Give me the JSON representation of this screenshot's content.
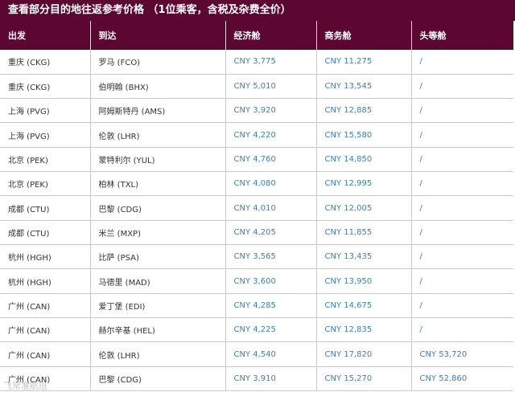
{
  "title": "查看部分目的地往返参考价格 （1位乘客，含税及杂费全价）",
  "columns": [
    "出发",
    "到达",
    "经济舱",
    "商务舱",
    "头等舱"
  ],
  "rows": [
    {
      "origin": "重庆 (CKG)",
      "destination": "罗马 (FCO)",
      "economy": "CNY 3,775",
      "business": "CNY 11,275",
      "first": "/"
    },
    {
      "origin": "重庆 (CKG)",
      "destination": "伯明翰 (BHX)",
      "economy": "CNY 5,010",
      "business": "CNY 13,545",
      "first": "/"
    },
    {
      "origin": "上海 (PVG)",
      "destination": "阿姆斯特丹 (AMS)",
      "economy": "CNY 3,920",
      "business": "CNY 12,885",
      "first": "/"
    },
    {
      "origin": "上海 (PVG)",
      "destination": "伦敦 (LHR)",
      "economy": "CNY 4,220",
      "business": "CNY 15,580",
      "first": "/"
    },
    {
      "origin": "北京 (PEK)",
      "destination": "蒙特利尔 (YUL)",
      "economy": "CNY 4,760",
      "business": "CNY 14,850",
      "first": "/"
    },
    {
      "origin": "北京 (PEK)",
      "destination": "柏林 (TXL)",
      "economy": "CNY 4,080",
      "business": "CNY 12,995",
      "first": "/"
    },
    {
      "origin": "成都 (CTU)",
      "destination": "巴黎 (CDG)",
      "economy": "CNY 4,010",
      "business": "CNY 12,005",
      "first": "/"
    },
    {
      "origin": "成都 (CTU)",
      "destination": "米兰 (MXP)",
      "economy": "CNY 4,205",
      "business": "CNY 11,855",
      "first": "/"
    },
    {
      "origin": "杭州 (HGH)",
      "destination": "比萨 (PSA)",
      "economy": "CNY 3,565",
      "business": "CNY 13,435",
      "first": "/"
    },
    {
      "origin": "杭州 (HGH)",
      "destination": "马德里 (MAD)",
      "economy": "CNY 3,600",
      "business": "CNY 13,950",
      "first": "/"
    },
    {
      "origin": "广州 (CAN)",
      "destination": "爱丁堡 (EDI)",
      "economy": "CNY 4,285",
      "business": "CNY 14,675",
      "first": "/"
    },
    {
      "origin": "广州 (CAN)",
      "destination": "赫尔辛基 (HEL)",
      "economy": "CNY 4,225",
      "business": "CNY 12,835",
      "first": "/"
    },
    {
      "origin": "广州 (CAN)",
      "destination": "伦敦 (LHR)",
      "economy": "CNY 4,540",
      "business": "CNY 17,820",
      "first": "CNY 53,720"
    },
    {
      "origin": "广州 (CAN)",
      "destination": "巴黎 (CDG)",
      "economy": "CNY 3,910",
      "business": "CNY 15,270",
      "first": "CNY 52,860"
    }
  ],
  "watermark": "飞常准航班",
  "colors": {
    "header_bg": "#5c0632",
    "price_text": "#3f7fb2",
    "grid_line": "#c9c9c9"
  }
}
